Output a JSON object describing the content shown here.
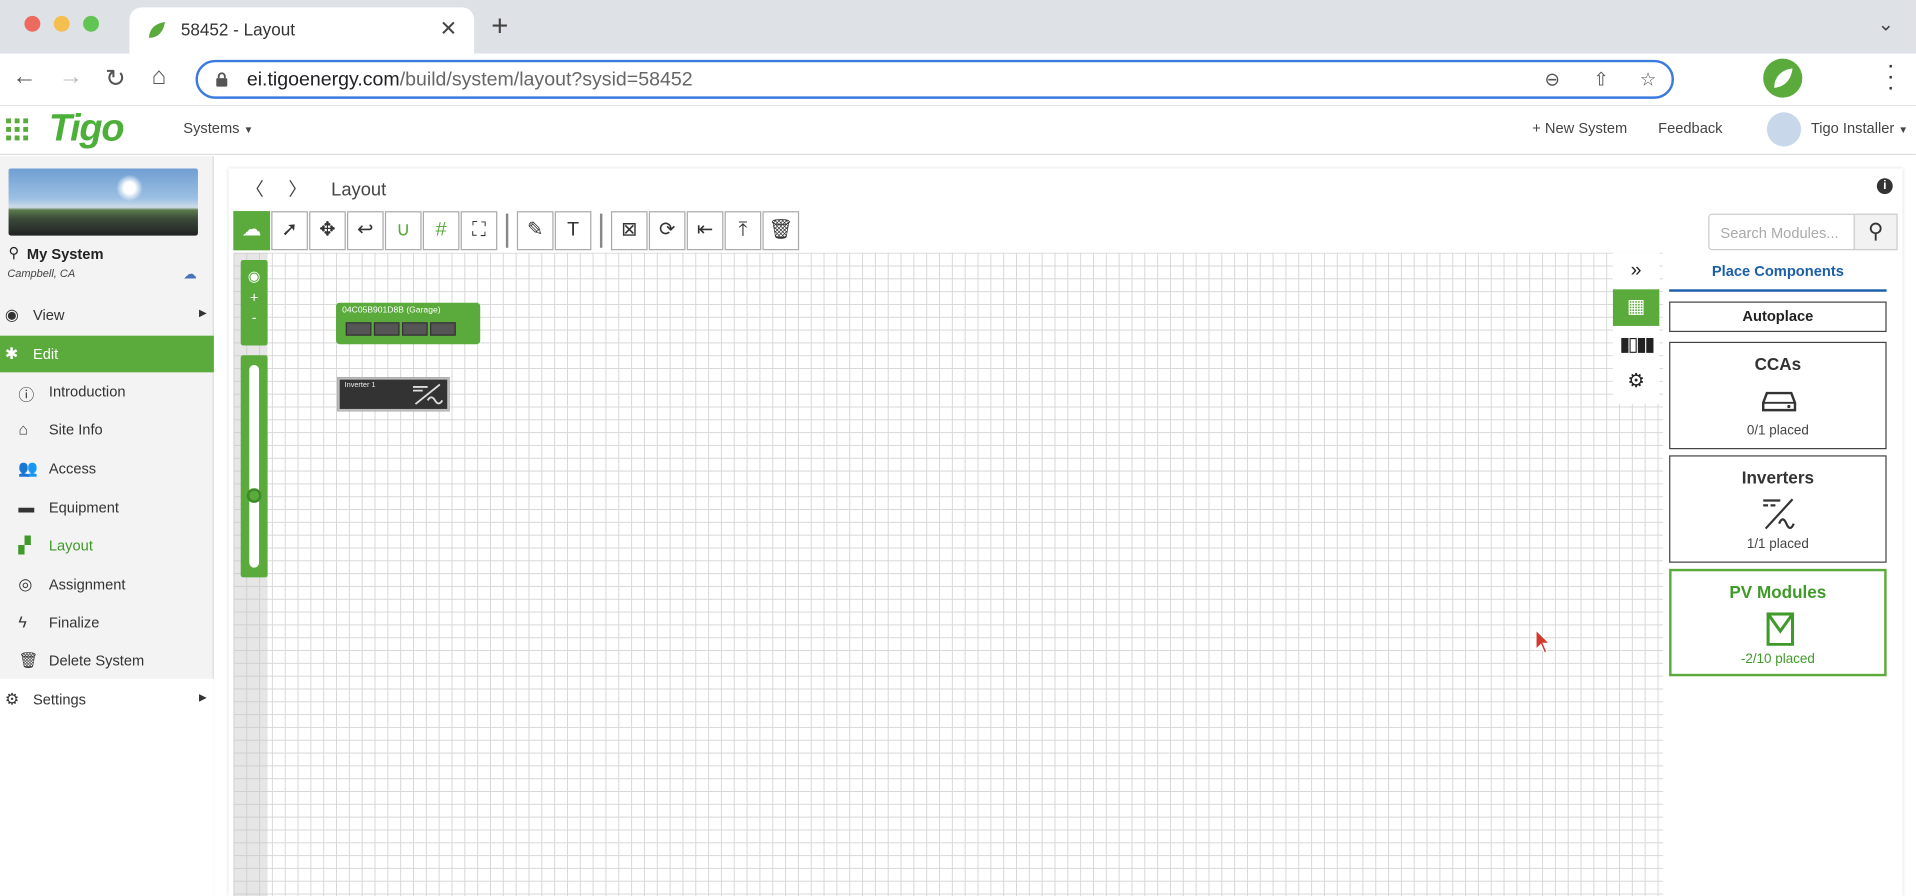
{
  "browser": {
    "tab_title": "58452 - Layout",
    "url_host": "ei.tigoenergy.com",
    "url_path": "/build/system/layout?sysid=58452"
  },
  "header": {
    "logo": "Tigo",
    "systems_menu": "Systems",
    "new_system": "New System",
    "feedback": "Feedback",
    "user": "Tigo Installer"
  },
  "sidebar": {
    "system_name": "My System",
    "system_location": "Campbell, CA",
    "items": [
      {
        "label": "View",
        "icon": "eye-icon"
      },
      {
        "label": "Edit",
        "icon": "wrench-icon"
      },
      {
        "label": "Introduction",
        "icon": "info-icon"
      },
      {
        "label": "Site Info",
        "icon": "house-icon"
      },
      {
        "label": "Access",
        "icon": "users-icon"
      },
      {
        "label": "Equipment",
        "icon": "toolbox-icon"
      },
      {
        "label": "Layout",
        "icon": "layout-icon"
      },
      {
        "label": "Assignment",
        "icon": "antenna-icon"
      },
      {
        "label": "Finalize",
        "icon": "bolt-icon"
      },
      {
        "label": "Delete System",
        "icon": "trash-icon"
      },
      {
        "label": "Settings",
        "icon": "gear-icon"
      }
    ]
  },
  "main": {
    "breadcrumb": "Layout",
    "search_placeholder": "Search Modules...",
    "canvas": {
      "module_label": "04C05B901D8B (Garage)",
      "inverter_label": "Inverter 1"
    },
    "panel": {
      "title": "Place Components",
      "autoplace": "Autoplace",
      "components": [
        {
          "name": "CCAs",
          "status": "0/1 placed",
          "icon": "cca-icon"
        },
        {
          "name": "Inverters",
          "status": "1/1 placed",
          "icon": "inverter-icon"
        },
        {
          "name": "PV Modules",
          "status": "-2/10 placed",
          "icon": "pv-module-icon"
        }
      ]
    }
  },
  "colors": {
    "accent": "#5aaa3c",
    "link": "#1a5fa8"
  }
}
